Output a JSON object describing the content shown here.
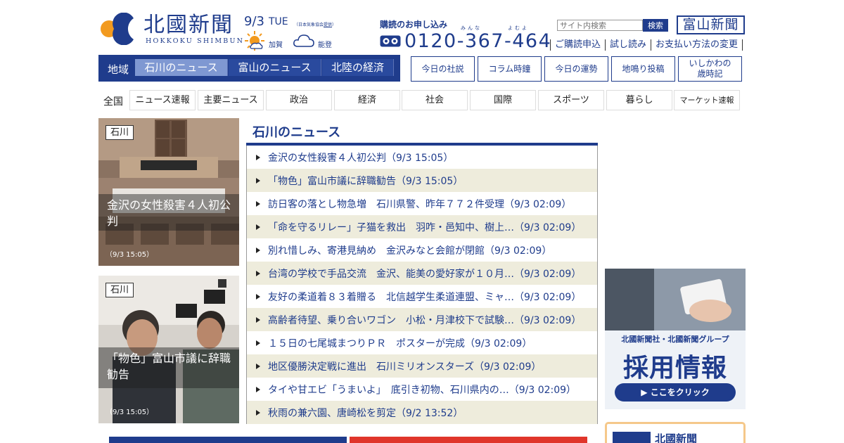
{
  "brand": {
    "logo_jp": "北國新聞",
    "logo_en": "HOKKOKU SHIMBUN"
  },
  "weather": {
    "date": "9/3",
    "weekday": "TUE",
    "source_prefix": "（日本気象協会",
    "source_link": "提供",
    "source_suffix": "）",
    "area1": "加賀",
    "area1_icon": "sun-icon",
    "area2": "能登",
    "area2_icon": "cloud-icon"
  },
  "subscription": {
    "title": "購読のお申し込み",
    "ruby1": "みんな",
    "ruby2": "よむよ",
    "phone": "0120-367-464"
  },
  "search": {
    "placeholder": "サイト内検索",
    "button": "検索"
  },
  "toyama_logo": "富山新聞",
  "top_links": [
    "ご購読申込",
    "試し読み",
    "お支払い方法の変更"
  ],
  "region_nav": {
    "label": "地域",
    "tabs": [
      "石川のニュース",
      "富山のニュース",
      "北陸の経済"
    ],
    "active_index": 0
  },
  "quick_links": [
    "今日の社説",
    "コラム時鐘",
    "今日の運勢",
    "地鳴り投稿",
    "いしかわの\n歳時記"
  ],
  "categories": {
    "label": "全国",
    "items": [
      "ニュース速報",
      "主要ニュース",
      "政治",
      "経済",
      "社会",
      "国際",
      "スポーツ",
      "暮らし",
      "マーケット速報"
    ]
  },
  "features": [
    {
      "tag": "石川",
      "caption": "金沢の女性殺害４人初公判",
      "time": "（9/3 15:05）"
    },
    {
      "tag": "石川",
      "caption": "「物色」富山市議に辞職勧告",
      "time": "（9/3 15:05）"
    }
  ],
  "news": {
    "title": "石川のニュース",
    "items": [
      "金沢の女性殺害４人初公判（9/3 15:05）",
      "「物色」富山市議に辞職勧告（9/3 15:05）",
      "訪日客の落とし物急増　石川県警、昨年７７２件受理（9/3 02:09）",
      "「命を守るリレー」子猫を救出　羽咋・邑知中、樹上…（9/3 02:09）",
      "別れ惜しみ、寄港見納め　金沢みなと会館が閉館（9/3 02:09）",
      "台湾の学校で手品交流　金沢、能美の愛好家が１０月…（9/3 02:09）",
      "友好の柔道着８３着贈る　北信越学生柔道連盟、ミャ…（9/3 02:09）",
      "高齢者待望、乗り合いワゴン　小松・月津校下で試験…（9/3 02:09）",
      "１５日の七尾城まつりＰＲ　ポスターが完成（9/3 02:09）",
      "地区優勝決定戦に進出　石川ミリオンスターズ（9/3 02:09）",
      "タイや甘エビ「うまいよ」　底引き初物、石川県内の…（9/3 02:09）",
      "秋雨の兼六園、唐崎松を剪定（9/2 13:52）"
    ]
  },
  "recruit_ad": {
    "line1": "北國新聞社・北國新聞グループ",
    "line2": "採用情報",
    "button": "▶ ここをクリック"
  },
  "mini_banner": {
    "text": "北國新聞"
  },
  "colors": {
    "brand_blue": "#1f3c8c",
    "active_tab": "#7f98d2",
    "row_alt": "#eeecdc",
    "logo_orange": "#f29a1f"
  }
}
